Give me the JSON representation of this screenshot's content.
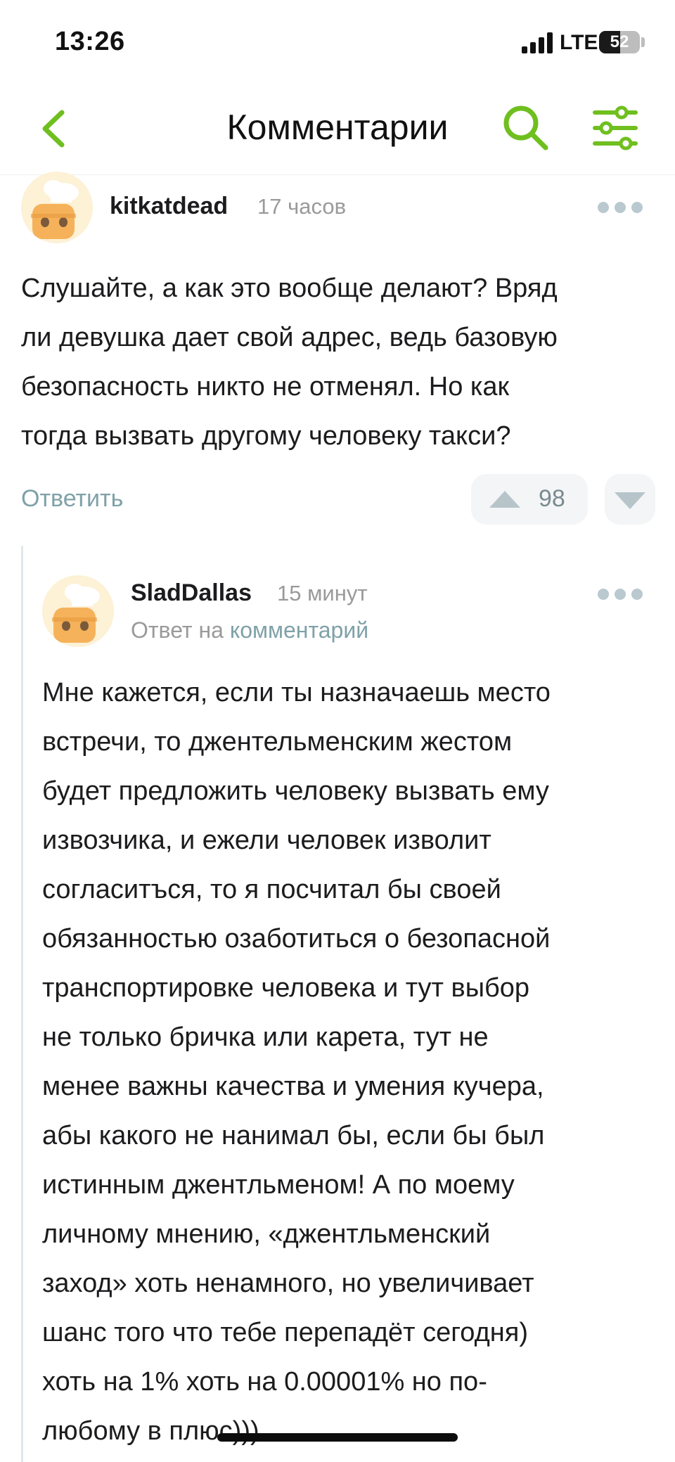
{
  "status_bar": {
    "time": "13:26",
    "network": "LTE",
    "battery": "52",
    "battery_level": 0.52
  },
  "header": {
    "title": "Комментарии"
  },
  "colors": {
    "accent": "#6fbf1f",
    "link": "#7fa1a8",
    "muted": "#9a9a9a"
  },
  "comments": [
    {
      "username": "kitkatdead",
      "time_ago": "17 часов",
      "lines": [
        "Слушайте, а как это вообще делают? Вряд",
        "ли девушка дает свой адрес, ведь базовую",
        "безопасность никто не отменял. Но как",
        "тогда вызвать другому человеку такси?"
      ],
      "reply_label": "Ответить",
      "rating": "98"
    },
    {
      "username": "SladDallas",
      "time_ago": "15 минут",
      "reply_to_prefix": "Ответ на",
      "reply_to_link": "комментарий",
      "lines": [
        "Мне кажется, если ты назначаешь место",
        "встречи, то джентельменским жестом",
        "будет предложить человеку вызвать ему",
        "извозчика, и ежели человек изволит",
        "согласитъся, то я посчитал бы своей",
        "обязанностью озаботиться о безопасной",
        "транспортировке человека и тут выбор",
        "не только бричка или карета, тут не",
        "менее важны качества и умения кучера,",
        "абы какого не нанимал бы, если бы был",
        "истинным джентльменом! А по моему",
        "личному мнению, «джентльменский",
        "заход» хоть ненамного, но увеличивает",
        "шанс того что тебе перепадёт сегодня)",
        "хоть на 1% хоть на 0.00001% но по-",
        "любому в плюс)))"
      ]
    }
  ]
}
